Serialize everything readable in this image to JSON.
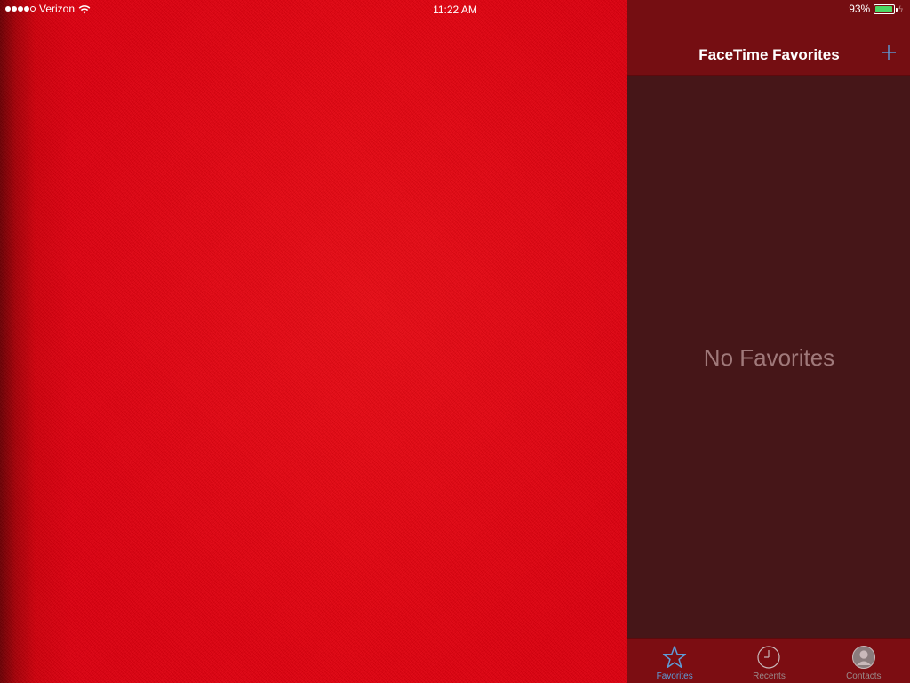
{
  "status_bar": {
    "carrier": "Verizon",
    "signal_bars": 5,
    "time": "11:22 AM",
    "battery": "93%",
    "battery_level": 0.93,
    "battery_color": "#4cd964"
  },
  "camera": {
    "tint": "#dc0010"
  },
  "favorites_panel": {
    "title": "FaceTime Favorites",
    "add_icon": "plus-icon",
    "empty_message": "No Favorites",
    "accent_color": "#5d9cd8"
  },
  "tab_bar": {
    "tabs": [
      {
        "label": "Favorites",
        "icon": "star-icon",
        "active": true
      },
      {
        "label": "Recents",
        "icon": "clock-icon",
        "active": false
      },
      {
        "label": "Contacts",
        "icon": "person-icon",
        "active": false
      }
    ]
  }
}
